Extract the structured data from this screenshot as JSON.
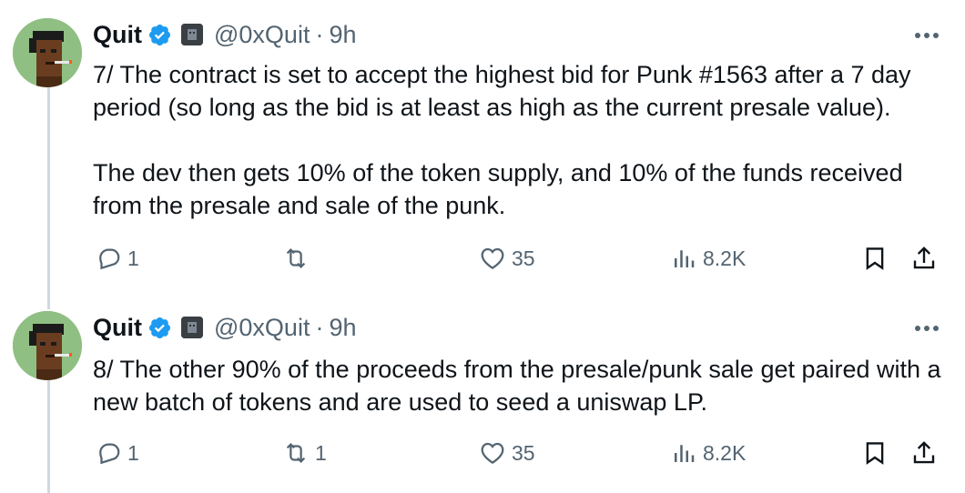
{
  "tweets": [
    {
      "author_name": "Quit",
      "handle": "@0xQuit",
      "separator": "·",
      "time": "9h",
      "text": "7/ The contract is set to accept the highest bid for Punk #1563 after a 7 day period (so long as the bid is at least as high as the current presale value).\n\nThe dev then gets 10% of the token supply, and 10% of the funds received from the presale and sale of the punk.",
      "replies": "1",
      "reposts": "",
      "likes": "35",
      "views": "8.2K"
    },
    {
      "author_name": "Quit",
      "handle": "@0xQuit",
      "separator": "·",
      "time": "9h",
      "text": "8/ The other 90% of the proceeds from the presale/punk sale get paired with a new batch of tokens and are used to seed a uniswap LP.",
      "replies": "1",
      "reposts": "1",
      "likes": "35",
      "views": "8.2K"
    }
  ],
  "icons": {
    "verified": "verified-badge-icon",
    "affiliate": "affiliate-badge-icon",
    "more": "more-options-icon",
    "reply": "reply-icon",
    "repost": "repost-icon",
    "like": "like-heart-icon",
    "views": "views-chart-icon",
    "bookmark": "bookmark-icon",
    "share": "share-icon"
  },
  "colors": {
    "verified_blue": "#1d9bf0",
    "secondary_text": "#536471",
    "thread_line": "#cfd9de"
  }
}
